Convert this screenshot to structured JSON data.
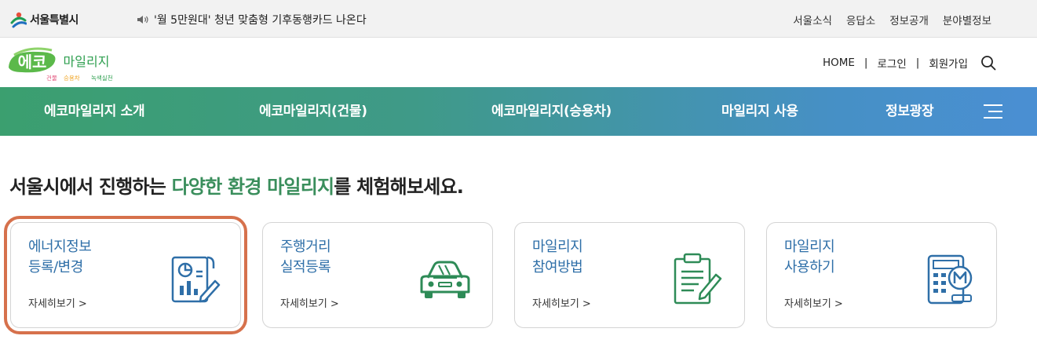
{
  "topbar": {
    "seoul_logo": "서울특별시",
    "notice": "'월 5만원대' 청년 맞춤형 기후동행카드 나온다",
    "links": [
      "서울소식",
      "응답소",
      "정보공개",
      "분야별정보"
    ]
  },
  "brand": {
    "logo_main": "에코",
    "logo_sub": "마일리지",
    "tag_building": "건물",
    "tag_car": "승용차",
    "tag_green": "녹색실천",
    "home": "HOME",
    "sep": "|",
    "login": "로그인",
    "join": "회원가입"
  },
  "nav": {
    "items": [
      "에코마일리지 소개",
      "에코마일리지(건물)",
      "에코마일리지(승용차)",
      "마일리지 사용",
      "정보광장"
    ]
  },
  "headline": {
    "prefix": "서울시에서 진행하는 ",
    "highlight": "다양한 환경 마일리지",
    "suffix": "를 체험해보세요."
  },
  "cards": [
    {
      "line1": "에너지정보",
      "line2": "등록/변경",
      "more": "자세히보기 >",
      "icon": "document-chart-icon"
    },
    {
      "line1": "주행거리",
      "line2": "실적등록",
      "more": "자세히보기 >",
      "icon": "car-icon"
    },
    {
      "line1": "마일리지",
      "line2": "참여방법",
      "more": "자세히보기 >",
      "icon": "clipboard-pen-icon"
    },
    {
      "line1": "마일리지",
      "line2": "사용하기",
      "more": "자세히보기 >",
      "icon": "calculator-icon"
    }
  ],
  "colors": {
    "nav_green": "#3b9f6f",
    "nav_blue": "#4a8fd3",
    "card_title": "#2f6fa8",
    "icon_blue": "#2f6fa8",
    "icon_green": "#2e8b57",
    "selection": "#d6714c",
    "headline_highlight": "#3a8e5c"
  }
}
